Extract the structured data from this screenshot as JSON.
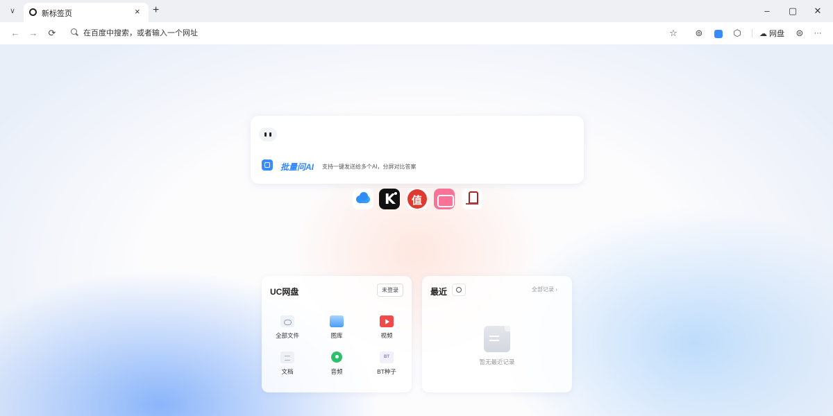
{
  "tabstrip": {
    "tab_title": "新标签页",
    "tab_menu_glyph": "∨",
    "close_glyph": "×",
    "new_tab_glyph": "+",
    "window_controls": {
      "minimize": "–",
      "maximize": "▢",
      "close": "✕"
    }
  },
  "toolbar": {
    "back_glyph": "←",
    "forward_glyph": "→",
    "reload_glyph": "⟳",
    "omnibox_placeholder": "在百度中搜索，或者输入一个网址",
    "star_glyph": "☆",
    "broadcast_glyph": "⊚",
    "extension_glyph": "⬡",
    "pan_label": "网盘",
    "pan_glyph": "☁",
    "account_glyph": "⊜",
    "more_glyph": "···"
  },
  "ai_card": {
    "brand": "批量问AI",
    "tagline": "支持一键发送给多个AI，分屏对比答案"
  },
  "shortcuts": {
    "k_glyph": "K",
    "zhi_glyph": "值"
  },
  "uc_pan": {
    "title": "UC网盘",
    "login_label": "未登录",
    "items": [
      {
        "label": "全部文件",
        "icon": "folder-icon"
      },
      {
        "label": "图库",
        "icon": "gallery-icon"
      },
      {
        "label": "视频",
        "icon": "video-icon"
      },
      {
        "label": "文档",
        "icon": "document-icon"
      },
      {
        "label": "音频",
        "icon": "audio-icon"
      },
      {
        "label": "BT种子",
        "icon": "bt-icon",
        "badge": "BT"
      }
    ]
  },
  "recent": {
    "title": "最近",
    "all_records_label": "全部记录 ›",
    "empty_text": "暂无最近记录"
  },
  "colors": {
    "accent": "#2f86ff",
    "video_red": "#f04a4a",
    "audio_green": "#2dbf6c",
    "bilibili_pink": "#fb7299",
    "zhi_red": "#e0392f"
  }
}
